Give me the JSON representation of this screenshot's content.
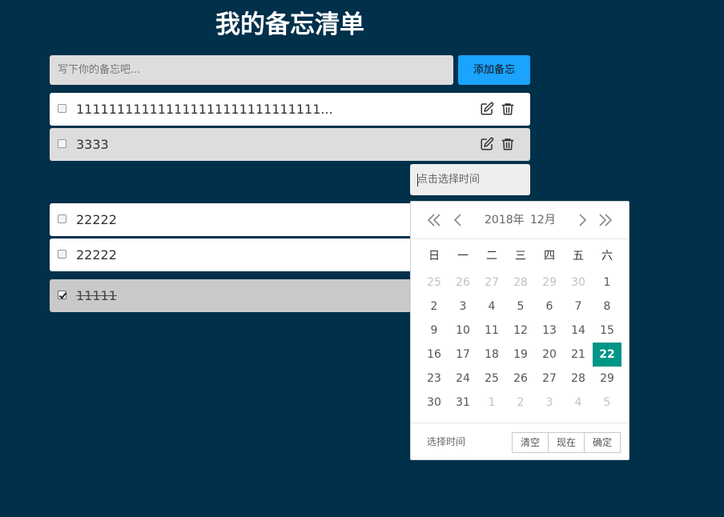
{
  "page": {
    "title": "我的备忘清单"
  },
  "new_todo": {
    "placeholder": "写下你的备忘吧...",
    "value": "",
    "add_label": "添加备忘"
  },
  "todos": [
    {
      "text": "111111111111111111111111111111...",
      "checked": false
    },
    {
      "text": "3333",
      "checked": false
    },
    {
      "text": "22222",
      "checked": false
    },
    {
      "text": "22222",
      "checked": false
    },
    {
      "text": "11111",
      "checked": true
    }
  ],
  "time_input": {
    "placeholder": "点击选择时间",
    "value": ""
  },
  "datepicker": {
    "year_label": "2018年",
    "month_label": "12月",
    "weekdays": [
      "日",
      "一",
      "二",
      "三",
      "四",
      "五",
      "六"
    ],
    "weeks": [
      [
        "25",
        "26",
        "27",
        "28",
        "29",
        "30",
        "1"
      ],
      [
        "2",
        "3",
        "4",
        "5",
        "6",
        "7",
        "8"
      ],
      [
        "9",
        "10",
        "11",
        "12",
        "13",
        "14",
        "15"
      ],
      [
        "16",
        "17",
        "18",
        "19",
        "20",
        "21",
        "22"
      ],
      [
        "23",
        "24",
        "25",
        "26",
        "27",
        "28",
        "29"
      ],
      [
        "30",
        "31",
        "1",
        "2",
        "3",
        "4",
        "5"
      ]
    ],
    "selected_day": "22",
    "footer_label": "选择时间",
    "clear_label": "清空",
    "now_label": "现在",
    "confirm_label": "确定",
    "selected_color": "#009688"
  },
  "colors": {
    "background": "#00304a",
    "add_button": "#1aa3ff"
  },
  "icons": {
    "edit": "edit-icon",
    "delete": "trash-icon",
    "prev_year": "double-chevron-left-icon",
    "prev_month": "chevron-left-icon",
    "next_month": "chevron-right-icon",
    "next_year": "double-chevron-right-icon"
  }
}
